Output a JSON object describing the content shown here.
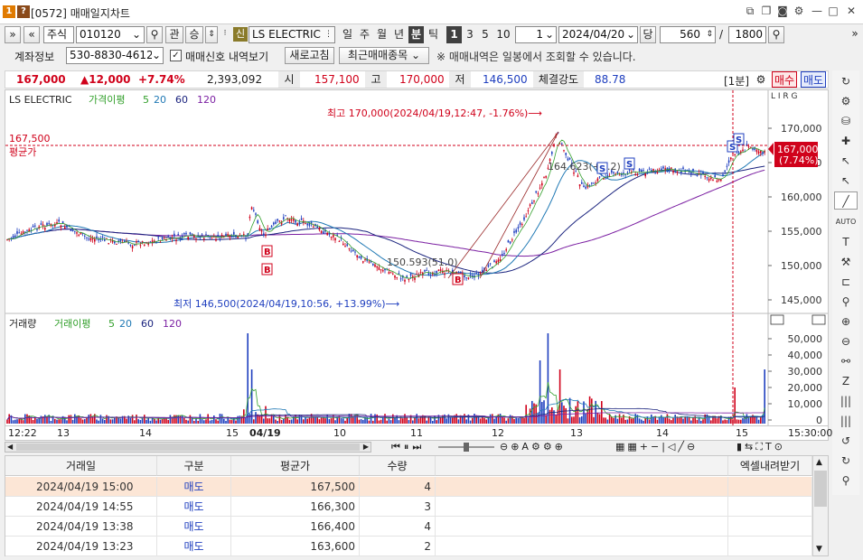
{
  "window": {
    "badge1": "1",
    "badge2": "?",
    "title": "[0572] 매매일지차트"
  },
  "toolbar1": {
    "type_select": "주식",
    "code": "010120",
    "btn_gwan": "관",
    "btn_seung": "승",
    "sin_badge": "신",
    "stock_name": "LS ELECTRIC",
    "periods": [
      "일",
      "주",
      "월",
      "년",
      "분",
      "틱"
    ],
    "active_period": "분",
    "intervals": [
      "1",
      "3",
      "5",
      "10"
    ],
    "active_interval": "1",
    "interval_value": "1",
    "date": "2024/04/20",
    "dang_label": "당",
    "count": "560",
    "slash": "/",
    "total": "1800"
  },
  "toolbar2": {
    "account_label": "계좌정보",
    "account_no": "530-8830-4612-",
    "signal_checkbox_label": "매매신호 내역보기",
    "refresh_btn": "새로고침",
    "recent_btn": "최근매매종목",
    "notice": "※ 매매내역은 일봉에서 조회할 수 있습니다."
  },
  "quote": {
    "price": "167,000",
    "change": "▲12,000",
    "rate": "+7.74%",
    "volume": "2,393,092",
    "open_label": "시",
    "open": "157,100",
    "high_label": "고",
    "high": "170,000",
    "low_label": "저",
    "low": "146,500",
    "strength_label": "체결강도",
    "strength": "88.78",
    "interval_tag": "[1분]",
    "buy_btn": "매수",
    "sell_btn": "매도"
  },
  "price_chart": {
    "legend_name": "LS ELECTRIC",
    "legend_ma_label": "가격이평",
    "ma_periods": [
      "5",
      "20",
      "60",
      "120"
    ],
    "ma_colors": [
      "#33a02c",
      "#1f78b4",
      "#1a237e",
      "#7b1fa2"
    ],
    "yaxis_badge": "L I R G",
    "y_ticks": [
      "170,000",
      "165,000",
      "160,000",
      "155,000",
      "150,000",
      "145,000"
    ],
    "max_annot": "최고 170,000(2024/04/19,12:47, -1.76%)⟶",
    "min_annot": "최저 146,500(2024/04/19,10:56, +13.99%)⟶",
    "avg_value": "167,500",
    "avg_label": "평균가",
    "current_price": "167,000",
    "current_rate": "(7.74%)",
    "fib1": "150.593(51.0)",
    "fib2": "164.623(+0.2)",
    "buy_marker": "B",
    "sell_marker": "S"
  },
  "volume_chart": {
    "legend_name": "거래량",
    "legend_ma_label": "거래이평",
    "ma_periods": [
      "5",
      "20",
      "60",
      "120"
    ],
    "y_ticks": [
      "50,000",
      "40,000",
      "30,000",
      "20,000",
      "10,000",
      "0"
    ]
  },
  "xaxis": {
    "labels": [
      "12:22",
      "13",
      "14",
      "15",
      "04/19",
      "10",
      "11",
      "12",
      "13",
      "14",
      "15"
    ],
    "right_time": "15:30:00"
  },
  "table": {
    "headers": [
      "거래일",
      "구분",
      "평균가",
      "수량",
      "엑셀내려받기"
    ],
    "rows": [
      {
        "date": "2024/04/19 15:00",
        "type": "매도",
        "price": "167,500",
        "qty": "4"
      },
      {
        "date": "2024/04/19 14:55",
        "type": "매도",
        "price": "166,300",
        "qty": "3"
      },
      {
        "date": "2024/04/19 13:38",
        "type": "매도",
        "price": "166,400",
        "qty": "4"
      },
      {
        "date": "2024/04/19 13:23",
        "type": "매도",
        "price": "163,600",
        "qty": "2"
      }
    ]
  },
  "colors": {
    "up": "#d0021b",
    "down": "#1f3fbf",
    "avg_line": "#d0021b"
  }
}
